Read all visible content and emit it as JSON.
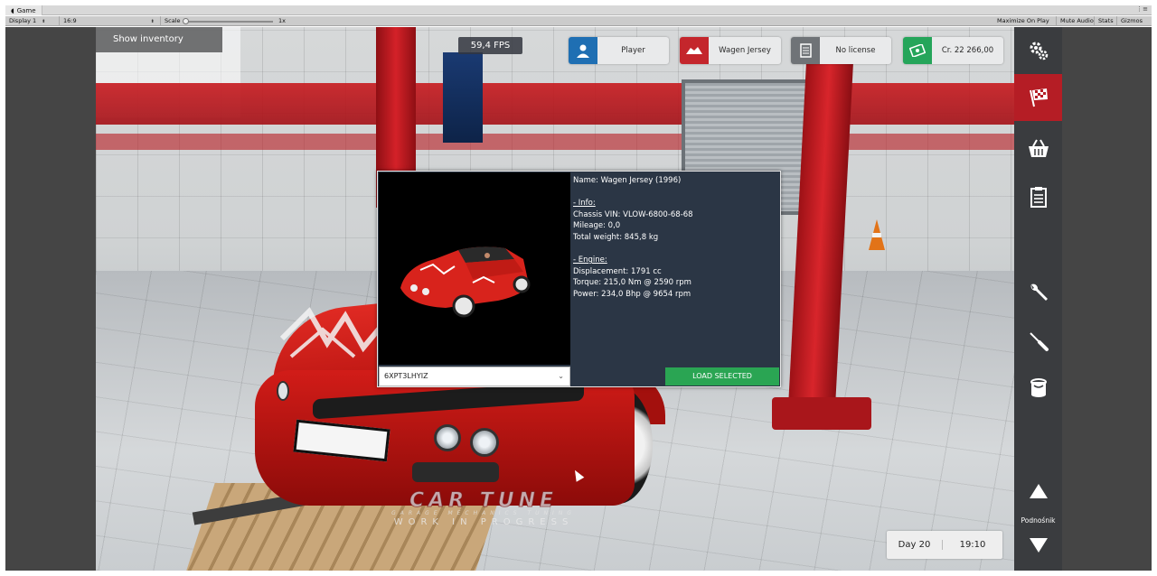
{
  "unity": {
    "tab_title": "Game",
    "display": "Display 1",
    "aspect": "16:9",
    "scale_label": "Scale",
    "scale_value": "1x",
    "toggles": [
      "Maximize On Play",
      "Mute Audio",
      "Stats",
      "Gizmos"
    ]
  },
  "hud": {
    "show_inventory": "Show inventory",
    "fps": "59,4 FPS",
    "player": "Player",
    "car_name": "Wagen Jersey",
    "license": "No license",
    "credits": "Cr. 22 266,00"
  },
  "dialog": {
    "name_line": "Name: Wagen Jersey (1996)",
    "info_header": "- Info:",
    "chassis_vin": "Chassis VIN: VLOW-6800-68-68",
    "mileage": "Mileage: 0,0",
    "total_weight": "Total weight: 845,8 kg",
    "engine_header": "- Engine:",
    "displacement": "Displacement: 1791 cc",
    "torque": "Torque: 215,0 Nm @ 2590 rpm",
    "power": "Power: 234,0 Bhp @ 9654 rpm",
    "selected_save": "6XPT3LHYIZ",
    "load_button": "LOAD SELECTED"
  },
  "sidebar": {
    "lift_label": "Podnośnik"
  },
  "status": {
    "day": "Day 20",
    "time": "19:10"
  },
  "watermark": {
    "logo": "CAR TUNE",
    "subtitle": "GARAGE MECHANICS TUNING",
    "wip": "WORK IN PROGRESS"
  },
  "colors": {
    "player_icon": "#1f6fb3",
    "car_icon": "#c4262c",
    "license_icon": "#6f7377",
    "credits_icon": "#25a55a",
    "load_button": "#2aa553",
    "sidebar_active": "#b51d25"
  }
}
